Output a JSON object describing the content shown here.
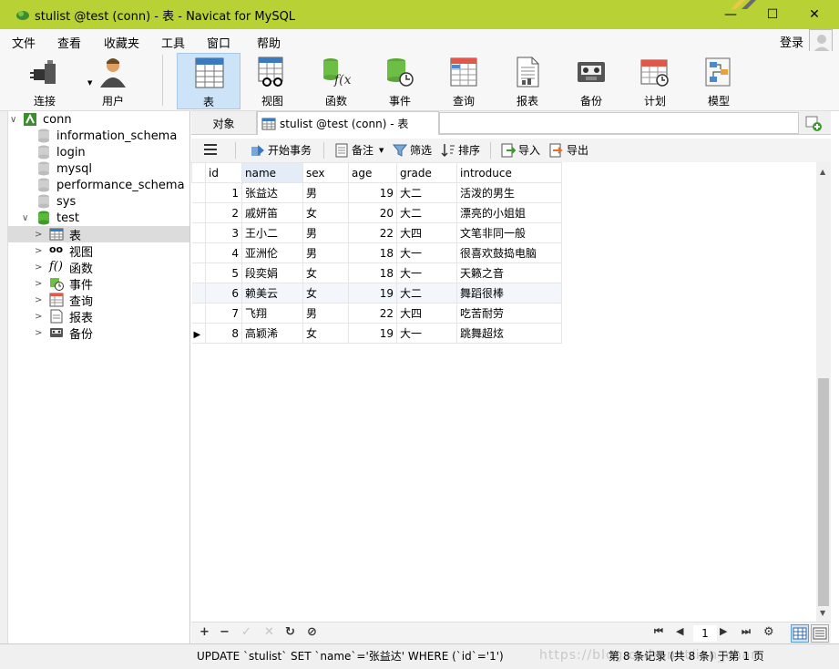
{
  "window": {
    "title": "stulist @test (conn) - 表 - Navicat for MySQL",
    "min": "—",
    "max": "☐",
    "close": "✕",
    "accent": "#b8d235"
  },
  "menu": {
    "items": [
      "文件",
      "查看",
      "收藏夹",
      "工具",
      "窗口",
      "帮助"
    ],
    "login": "登录"
  },
  "toolbar": {
    "items": [
      {
        "label": "连接",
        "icon": "plug-icon"
      },
      {
        "label": "用户",
        "icon": "user-icon"
      },
      {
        "label": "表",
        "icon": "table-icon"
      },
      {
        "label": "视图",
        "icon": "view-icon"
      },
      {
        "label": "函数",
        "icon": "function-icon"
      },
      {
        "label": "事件",
        "icon": "event-icon"
      },
      {
        "label": "查询",
        "icon": "query-icon"
      },
      {
        "label": "报表",
        "icon": "report-icon"
      },
      {
        "label": "备份",
        "icon": "backup-icon"
      },
      {
        "label": "计划",
        "icon": "schedule-icon"
      },
      {
        "label": "模型",
        "icon": "model-icon"
      }
    ]
  },
  "tree": {
    "connection": "conn",
    "databases": [
      "information_schema",
      "login",
      "mysql",
      "performance_schema",
      "sys"
    ],
    "open_db": "test",
    "children": [
      "表",
      "视图",
      "函数",
      "事件",
      "查询",
      "报表",
      "备份"
    ]
  },
  "tabs": {
    "objects": "对象",
    "current": "stulist @test (conn) - 表"
  },
  "data_toolbar": {
    "begin_tx": "开始事务",
    "note": "备注",
    "filter": "筛选",
    "sort": "排序",
    "import": "导入",
    "export": "导出"
  },
  "grid": {
    "columns": [
      "id",
      "name",
      "sex",
      "age",
      "grade",
      "introduce"
    ],
    "rows": [
      [
        "1",
        "张益达",
        "男",
        "19",
        "大二",
        "活泼的男生"
      ],
      [
        "2",
        "戚妍笛",
        "女",
        "20",
        "大二",
        "漂亮的小姐姐"
      ],
      [
        "3",
        "王小二",
        "男",
        "22",
        "大四",
        "文笔非同一般"
      ],
      [
        "4",
        "亚洲伦",
        "男",
        "18",
        "大一",
        "很喜欢鼓捣电脑"
      ],
      [
        "5",
        "段奕娟",
        "女",
        "18",
        "大一",
        "天籁之音"
      ],
      [
        "6",
        "赖美云",
        "女",
        "19",
        "大二",
        "舞蹈很棒"
      ],
      [
        "7",
        "飞翔",
        "男",
        "22",
        "大四",
        "吃苦耐劳"
      ],
      [
        "8",
        "高颖浠",
        "女",
        "19",
        "大一",
        "跳舞超炫"
      ]
    ]
  },
  "navigator": {
    "add": "+",
    "remove": "−",
    "apply": "✓",
    "discard": "✕",
    "refresh": "↻",
    "stop": "⊘",
    "first": "⏮",
    "prev": "◀",
    "page": "1",
    "next": "▶",
    "last": "⏭",
    "settings": "⚙"
  },
  "status": {
    "sql": "UPDATE `stulist` SET `name`='张益达' WHERE (`id`='1')",
    "records": "第 8 条记录 (共 8 条) 于第 1 页",
    "watermark": "https://blog.csdn.net/ion_chan"
  }
}
